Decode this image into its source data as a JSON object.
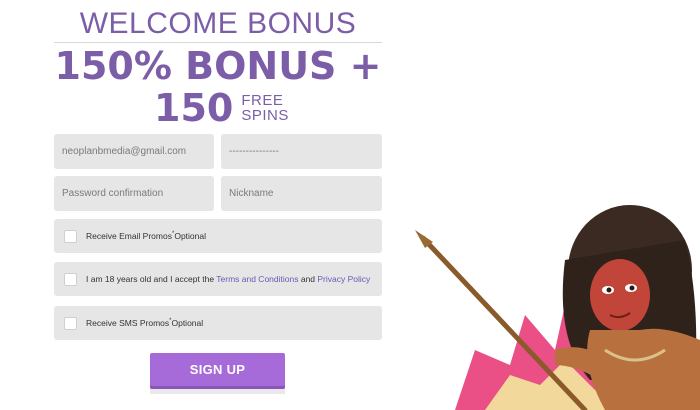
{
  "header": {
    "title": "WELCOME BONUS",
    "bonus": "150% BONUS +",
    "spins_number": "150",
    "spins_free": "FREE",
    "spins_word": "SPINS"
  },
  "form": {
    "email_value": "neoplanbmedia@gmail.com",
    "password_value": "---------------",
    "password_confirm_placeholder": "Password confirmation",
    "nickname_placeholder": "Nickname",
    "email_promos_label": "Receive Email Promos",
    "email_promos_sup": "*",
    "email_promos_optional": "Optional",
    "age_text": "I am 18 years old and I accept the ",
    "terms_link": "Terms and Conditions",
    "and_text": " and ",
    "privacy_link": "Privacy Policy",
    "sms_promos_label": "Receive SMS Promos",
    "sms_promos_sup": "*",
    "sms_promos_optional": "Optional",
    "signup_label": "SIGN UP"
  },
  "colors": {
    "brand_purple": "#7b5ea7",
    "button": "#a66ad9",
    "link": "#6b58b5",
    "field_bg": "#e6e6e6"
  }
}
